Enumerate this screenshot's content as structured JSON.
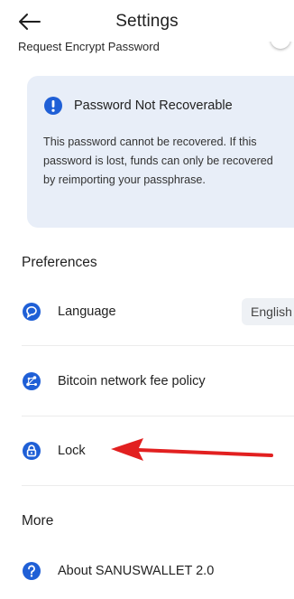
{
  "header": {
    "title": "Settings",
    "back_icon": "arrow-left-icon"
  },
  "clipped_row": {
    "label": "Request Encrypt Password"
  },
  "notice": {
    "icon": "info-icon",
    "title": "Password Not Recoverable",
    "body": "This password cannot be recovered. If this password is lost, funds can only be recovered by reimporting your passphrase."
  },
  "preferences": {
    "title": "Preferences",
    "items": [
      {
        "label": "Language",
        "icon": "chat-bubble-icon",
        "value": "English"
      },
      {
        "label": "Bitcoin network fee policy",
        "icon": "network-icon"
      },
      {
        "label": "Lock",
        "icon": "lock-icon"
      }
    ]
  },
  "more": {
    "title": "More",
    "items": [
      {
        "label": "About SANUSWALLET 2.0",
        "icon": "help-icon"
      }
    ]
  },
  "colors": {
    "accent": "#1f5fd6",
    "annotation_arrow": "#e22020",
    "notice_bg": "#e8eef8"
  }
}
